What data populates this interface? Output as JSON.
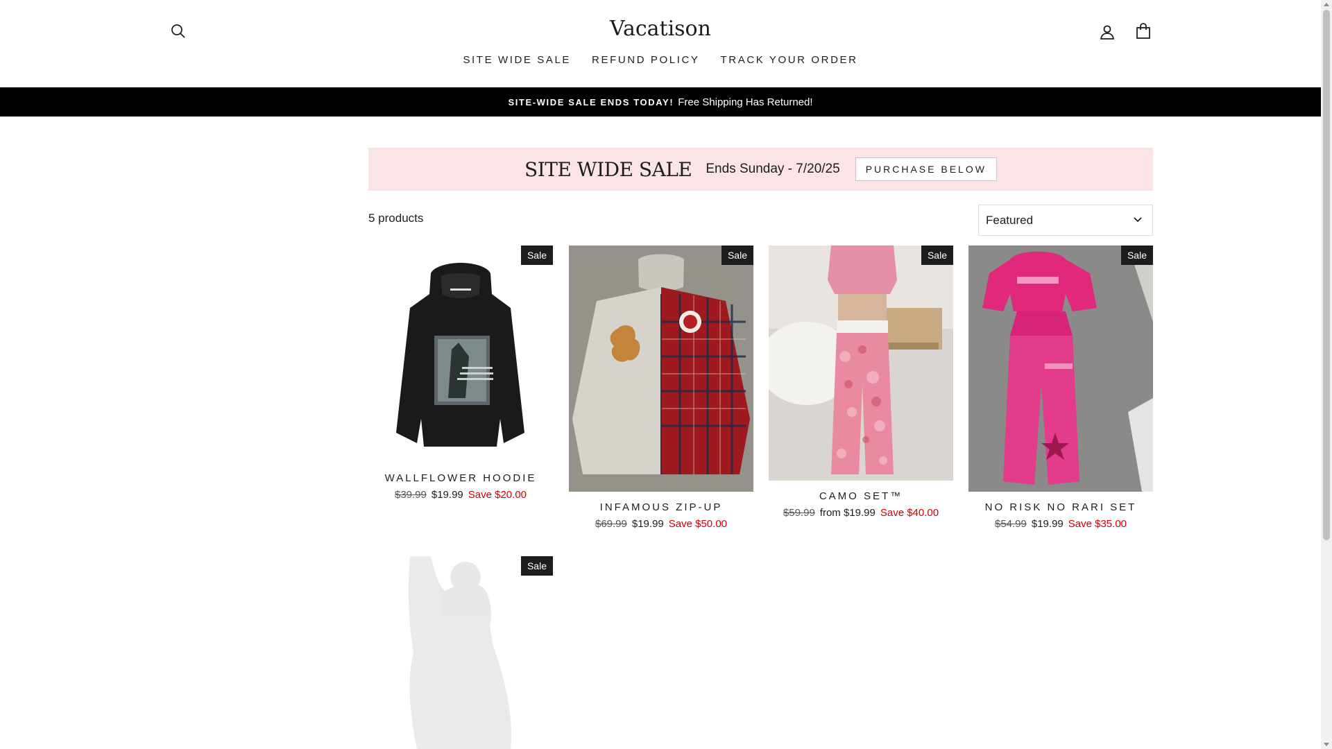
{
  "header": {
    "logo": "Vacatison",
    "nav": [
      "SITE WIDE SALE",
      "REFUND POLICY",
      "TRACK YOUR ORDER"
    ]
  },
  "announcement": {
    "strong": "SITE-WIDE SALE ENDS TODAY!",
    "text": "Free Shipping Has Returned!"
  },
  "banner": {
    "title": "SITE WIDE SALE",
    "subtitle": "Ends Sunday - 7/20/25",
    "button": "PURCHASE BELOW"
  },
  "toolbar": {
    "count": "5 products",
    "sort_selected": "Featured"
  },
  "products": [
    {
      "name": "WALLFLOWER HOODIE",
      "regular": "$39.99",
      "price": "$19.99",
      "save": "Save $20.00",
      "badge": "Sale"
    },
    {
      "name": "INFAMOUS ZIP-UP",
      "regular": "$69.99",
      "price": "$19.99",
      "save": "Save $50.00",
      "badge": "Sale"
    },
    {
      "name": "CAMO SET™",
      "regular": "$59.99",
      "price": "from $19.99",
      "save": "Save $40.00",
      "badge": "Sale"
    },
    {
      "name": "NO RISK NO RARI SET",
      "regular": "$54.99",
      "price": "$19.99",
      "save": "Save $35.00",
      "badge": "Sale"
    },
    {
      "badge": "Sale"
    }
  ],
  "colors": {
    "announcement_bg": "#000000",
    "banner_bg": "#fbe4e6",
    "save_text": "#d20000",
    "badge_bg": "#1c1d1d"
  }
}
